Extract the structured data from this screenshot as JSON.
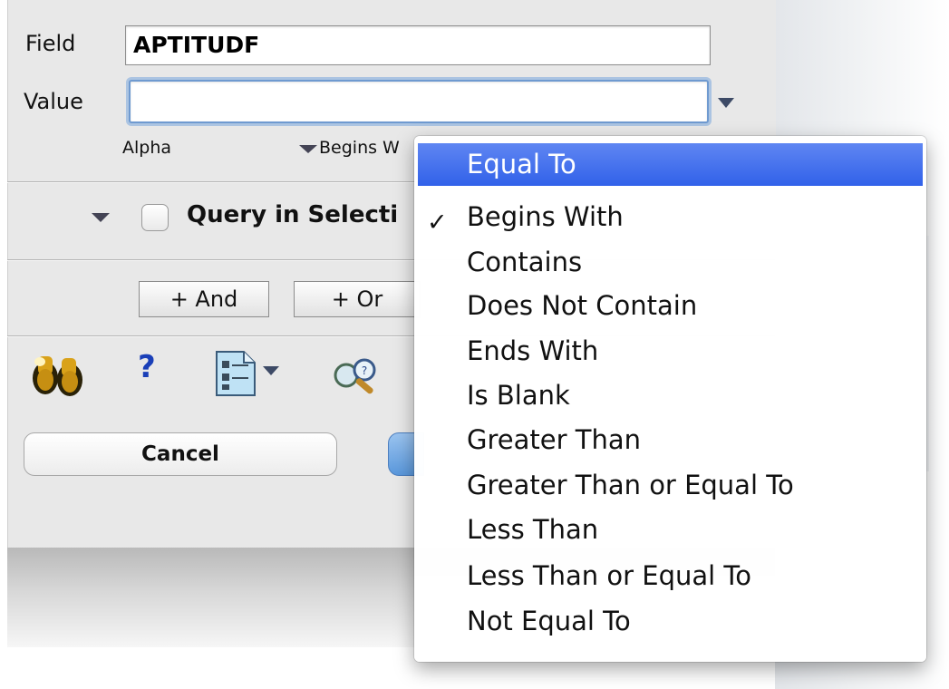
{
  "form": {
    "field_label": "Field",
    "field_value": "APTITUDF",
    "value_label": "Value",
    "value_input": "",
    "type_label": "Alpha",
    "operator_label": "Begins With",
    "operator_visible_text": "Begins W"
  },
  "query": {
    "selection_label": "Query in Selection",
    "selection_visible_text": "Query in Selecti",
    "checked": false
  },
  "buttons": {
    "and_label": "+ And",
    "or_label": "+ Or",
    "cancel_label": "Cancel"
  },
  "toolbar": {
    "icons": [
      "binoculars-icon",
      "help-icon",
      "document-icon",
      "search-magnifier-icon"
    ],
    "help_glyph": "?"
  },
  "menu": {
    "items": [
      {
        "label": "Equal To",
        "highlighted": true,
        "checked": false
      },
      {
        "label": "Begins With",
        "highlighted": false,
        "checked": true
      },
      {
        "label": "Contains",
        "highlighted": false,
        "checked": false
      },
      {
        "label": "Does Not Contain",
        "highlighted": false,
        "checked": false
      },
      {
        "label": "Ends With",
        "highlighted": false,
        "checked": false
      },
      {
        "label": "Is Blank",
        "highlighted": false,
        "checked": false
      },
      {
        "label": "Greater Than",
        "highlighted": false,
        "checked": false
      },
      {
        "label": "Greater Than or Equal To",
        "highlighted": false,
        "checked": false
      },
      {
        "label": "Less Than",
        "highlighted": false,
        "checked": false
      },
      {
        "label": "Less Than or Equal To",
        "highlighted": false,
        "checked": false
      },
      {
        "label": "Not Equal To",
        "highlighted": false,
        "checked": false
      }
    ],
    "check_glyph": "✓"
  }
}
